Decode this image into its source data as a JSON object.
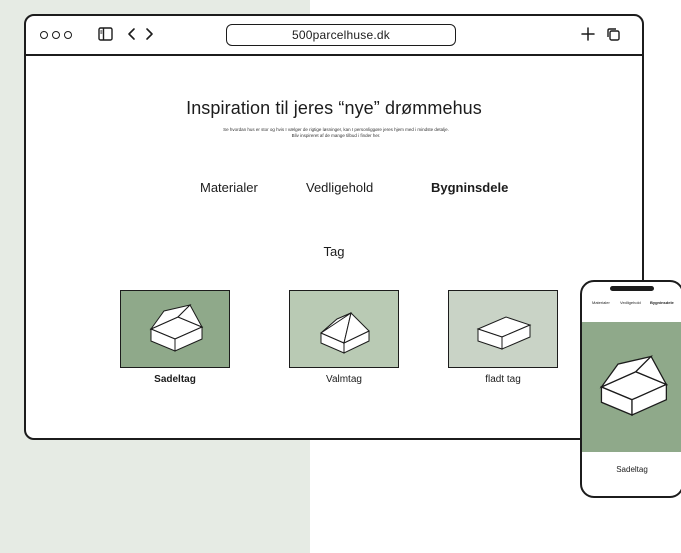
{
  "browser": {
    "url": "500parcelhuse.dk"
  },
  "page": {
    "title": "Inspiration til jeres “nye” drømmehus",
    "subtitle_line1": "Se hvordan hus er stor og hvis I vælger de rigtige løsninger, kan I personliggøre jeres hjem med i mindste detalje.",
    "subtitle_line2": "Bliv inspireret af de mange tilbud i finder her.",
    "tabs": [
      {
        "label": "Materialer"
      },
      {
        "label": "Vedligehold"
      },
      {
        "label": "Bygninsdele"
      }
    ],
    "section_title": "Tag",
    "cards": [
      {
        "label": "Sadeltag",
        "color": "#8fa98a"
      },
      {
        "label": "Valmtag",
        "color": "#b9cab4"
      },
      {
        "label": "fladt tag",
        "color": "#c9d3c6"
      }
    ]
  },
  "phone": {
    "tabs": [
      {
        "label": "Materialer"
      },
      {
        "label": "Vedligehold"
      },
      {
        "label": "Bygninsdele"
      }
    ],
    "card_label": "Sadeltag"
  }
}
